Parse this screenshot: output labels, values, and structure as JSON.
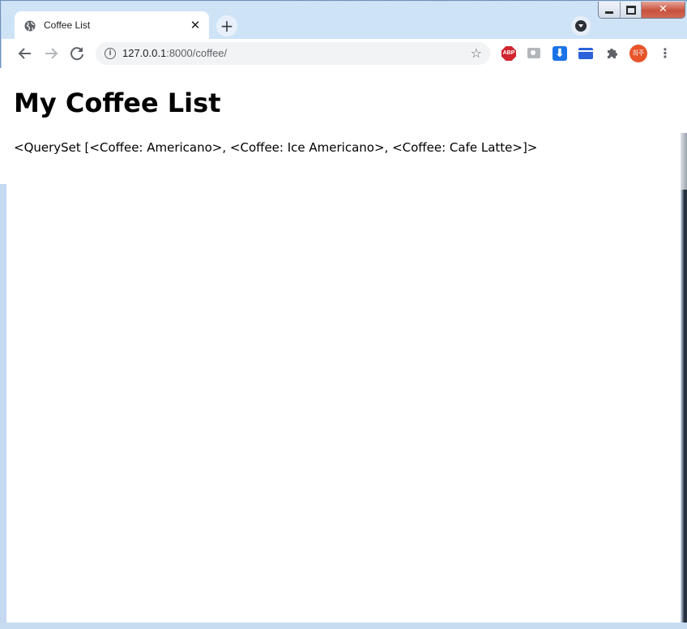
{
  "browser": {
    "tab": {
      "title": "Coffee List",
      "close_glyph": "✕",
      "icon": "globe-icon"
    },
    "new_tab_glyph": "+",
    "toolbar": {
      "back_glyph": "←",
      "forward_glyph": "→",
      "reload_glyph": "↻",
      "url_host": "127.0.0.1",
      "url_rest": ":8000/coffee/",
      "star_glyph": "☆",
      "info_glyph": "i"
    },
    "extensions": {
      "abp_label": "ABP",
      "download_glyph": "⬇",
      "puzzle_glyph": "✱",
      "avatar_text": "희주",
      "menu_glyph": "⋮"
    },
    "window_controls": {
      "close_glyph": "✕"
    }
  },
  "page": {
    "heading": "My Coffee List",
    "queryset_text": "<QuerySet [<Coffee: Americano>, <Coffee: Ice Americano>, <Coffee: Cafe Latte>]>"
  }
}
